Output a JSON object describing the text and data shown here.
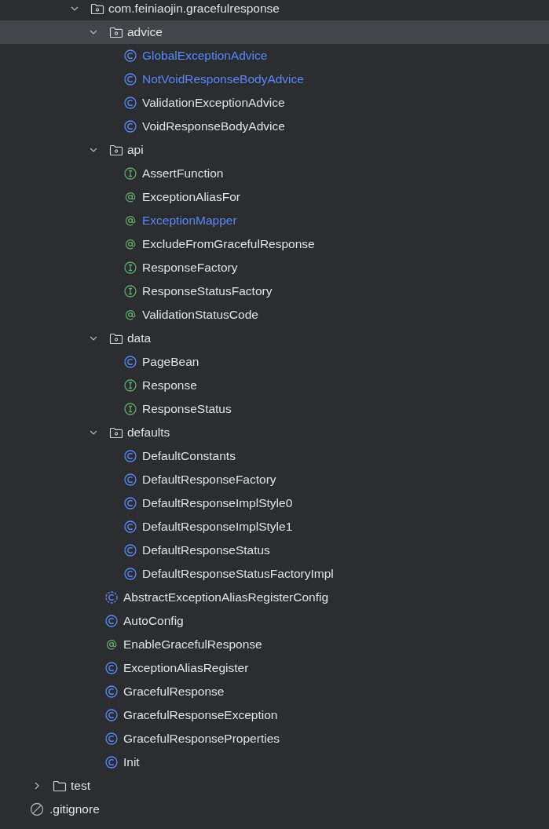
{
  "tree": [
    {
      "label": "com.feiniaojin.gracefulresponse",
      "kind": "package",
      "expanded": true,
      "selected": false,
      "modified": false,
      "children": [
        {
          "label": "advice",
          "kind": "package",
          "expanded": true,
          "selected": true,
          "modified": false,
          "children": [
            {
              "label": "GlobalExceptionAdvice",
              "kind": "class",
              "selected": false,
              "modified": true
            },
            {
              "label": "NotVoidResponseBodyAdvice",
              "kind": "class",
              "selected": false,
              "modified": true
            },
            {
              "label": "ValidationExceptionAdvice",
              "kind": "class",
              "selected": false,
              "modified": false
            },
            {
              "label": "VoidResponseBodyAdvice",
              "kind": "class",
              "selected": false,
              "modified": false
            }
          ]
        },
        {
          "label": "api",
          "kind": "package",
          "expanded": true,
          "selected": false,
          "modified": false,
          "children": [
            {
              "label": "AssertFunction",
              "kind": "interface",
              "selected": false,
              "modified": false
            },
            {
              "label": "ExceptionAliasFor",
              "kind": "annotation",
              "selected": false,
              "modified": false
            },
            {
              "label": "ExceptionMapper",
              "kind": "annotation",
              "selected": false,
              "modified": true
            },
            {
              "label": "ExcludeFromGracefulResponse",
              "kind": "annotation",
              "selected": false,
              "modified": false
            },
            {
              "label": "ResponseFactory",
              "kind": "interface",
              "selected": false,
              "modified": false
            },
            {
              "label": "ResponseStatusFactory",
              "kind": "interface",
              "selected": false,
              "modified": false
            },
            {
              "label": "ValidationStatusCode",
              "kind": "annotation",
              "selected": false,
              "modified": false
            }
          ]
        },
        {
          "label": "data",
          "kind": "package",
          "expanded": true,
          "selected": false,
          "modified": false,
          "children": [
            {
              "label": "PageBean",
              "kind": "class",
              "selected": false,
              "modified": false
            },
            {
              "label": "Response",
              "kind": "interface",
              "selected": false,
              "modified": false
            },
            {
              "label": "ResponseStatus",
              "kind": "interface",
              "selected": false,
              "modified": false
            }
          ]
        },
        {
          "label": "defaults",
          "kind": "package",
          "expanded": true,
          "selected": false,
          "modified": false,
          "children": [
            {
              "label": "DefaultConstants",
              "kind": "class",
              "selected": false,
              "modified": false
            },
            {
              "label": "DefaultResponseFactory",
              "kind": "class",
              "selected": false,
              "modified": false
            },
            {
              "label": "DefaultResponseImplStyle0",
              "kind": "class",
              "selected": false,
              "modified": false
            },
            {
              "label": "DefaultResponseImplStyle1",
              "kind": "class",
              "selected": false,
              "modified": false
            },
            {
              "label": "DefaultResponseStatus",
              "kind": "class",
              "selected": false,
              "modified": false
            },
            {
              "label": "DefaultResponseStatusFactoryImpl",
              "kind": "class",
              "selected": false,
              "modified": false
            }
          ]
        },
        {
          "label": "AbstractExceptionAliasRegisterConfig",
          "kind": "abstract",
          "selected": false,
          "modified": false
        },
        {
          "label": "AutoConfig",
          "kind": "class",
          "selected": false,
          "modified": false
        },
        {
          "label": "EnableGracefulResponse",
          "kind": "annotation",
          "selected": false,
          "modified": false
        },
        {
          "label": "ExceptionAliasRegister",
          "kind": "class",
          "selected": false,
          "modified": false
        },
        {
          "label": "GracefulResponse",
          "kind": "class",
          "selected": false,
          "modified": false
        },
        {
          "label": "GracefulResponseException",
          "kind": "class",
          "selected": false,
          "modified": false
        },
        {
          "label": "GracefulResponseProperties",
          "kind": "class",
          "selected": false,
          "modified": false
        },
        {
          "label": "Init",
          "kind": "class",
          "selected": false,
          "modified": false
        }
      ]
    },
    {
      "label": "test",
      "kind": "folder",
      "expanded": false,
      "selected": false,
      "modified": false
    },
    {
      "label": ".gitignore",
      "kind": "ignored",
      "selected": false,
      "modified": false
    }
  ]
}
